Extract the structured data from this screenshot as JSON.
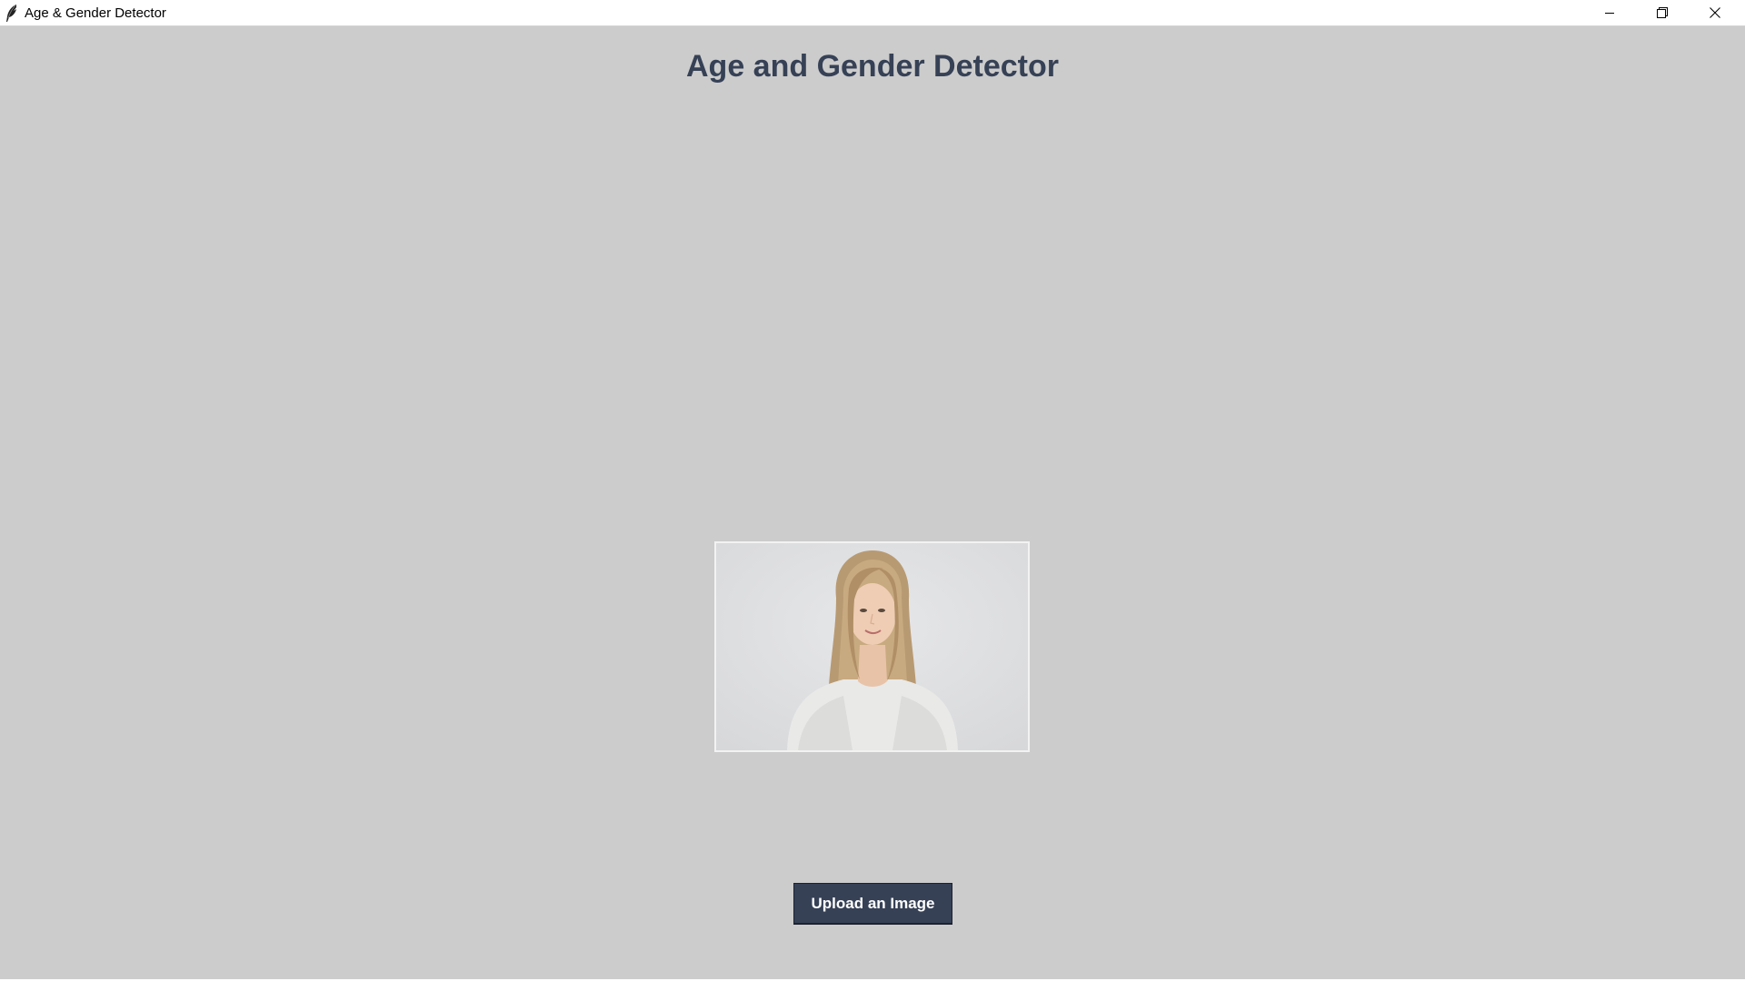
{
  "window": {
    "title": "Age & Gender Detector",
    "icon": "feather-icon",
    "controls": [
      "minimize-icon",
      "restore-icon",
      "close-icon"
    ]
  },
  "main": {
    "heading": "Age and Gender Detector",
    "image": {
      "description_icon": "portrait-photo"
    },
    "upload_button_label": "Upload an Image"
  },
  "colors": {
    "background": "#cccccc",
    "heading_text": "#364156",
    "button_background": "#364156",
    "button_text": "#ffffff"
  }
}
